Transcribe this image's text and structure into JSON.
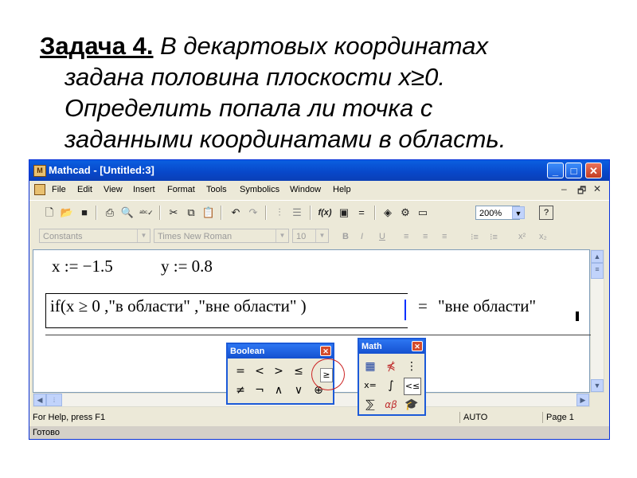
{
  "heading": {
    "task": "Задача 4.",
    "line1": " В декартовых координатах",
    "line2": "задана половина плоскости x≥0.",
    "line3": "Определить попала ли точка с",
    "line4": "заданными координатами в область."
  },
  "window": {
    "title": "Mathcad - [Untitled:3]",
    "app_icon_letter": "M",
    "controls": {
      "minimize": "_",
      "maximize": "□",
      "close": "✕"
    }
  },
  "menu": [
    "File",
    "Edit",
    "View",
    "Insert",
    "Format",
    "Tools",
    "Symbolics",
    "Window",
    "Help"
  ],
  "mdi_controls": [
    "–",
    "🗗",
    "✕"
  ],
  "toolbar": {
    "zoom": "200%",
    "help": "?",
    "icons": [
      "new-icon",
      "open-icon",
      "save-icon",
      "print-icon",
      "print-preview-icon",
      "spell-check-icon",
      "cut-icon",
      "copy-icon",
      "paste-icon",
      "undo-icon",
      "redo-icon",
      "align-across-icon",
      "align-down-icon",
      "insert-function-icon",
      "insert-unit-icon",
      "calculate-icon",
      "resource-center-icon",
      "component-icon"
    ]
  },
  "format_bar": {
    "style": "Constants",
    "font": "Times New Roman",
    "size": "10",
    "bold": "B",
    "italic": "I",
    "underline": "U",
    "superscript": "x²",
    "subscript": "x₂"
  },
  "worksheet": {
    "assign_x": "x := −1.5",
    "assign_y": "y := 0.8",
    "if_expr": "if(x ≥ 0 ,\"в области\" ,\"вне области\" )",
    "eq": "=",
    "result": "\"вне области\""
  },
  "status": {
    "help": "For Help, press F1",
    "mode": "AUTO",
    "page": "Page 1",
    "ready": "Готово"
  },
  "boolean_palette": {
    "title": "Boolean",
    "row1": [
      "=",
      "<",
      ">",
      "≤",
      "≥"
    ],
    "row2": [
      "≠",
      "¬",
      "∧",
      "∨",
      "⊕"
    ]
  },
  "math_palette": {
    "title": "Math"
  }
}
